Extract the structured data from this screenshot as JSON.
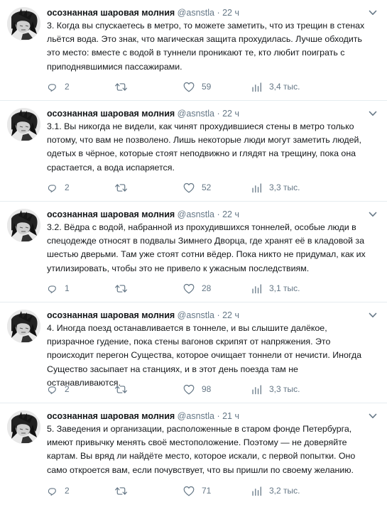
{
  "tweets": [
    {
      "name": "осознанная шаровая молния",
      "handle": "@asnstla",
      "dot": "·",
      "time": "22 ч",
      "text": "3. Когда вы спускаетесь в метро, то можете заметить, что из трещин в стенах льётся вода. Это знак, что магическая защита прохудилась. Лучше обходить это место: вместе с водой в туннели проникают те, кто любит поиграть с приподнявшимися пассажирами.",
      "replies": "2",
      "retweets": "",
      "likes": "59",
      "views": "3,4 тыс."
    },
    {
      "name": "осознанная шаровая молния",
      "handle": "@asnstla",
      "dot": "·",
      "time": "22 ч",
      "text": "3.1. Вы никогда не видели, как чинят прохудившиеся стены в метро только потому, что вам не позволено. Лишь некоторые люди могут заметить людей, одетых в чёрное, которые стоят неподвижно и глядят на трещину, пока она срастается, а вода испаряется.",
      "replies": "2",
      "retweets": "",
      "likes": "52",
      "views": "3,3 тыс."
    },
    {
      "name": "осознанная шаровая молния",
      "handle": "@asnstla",
      "dot": "·",
      "time": "22 ч",
      "text": "3.2. Вёдра с водой, набранной из прохудившихся тоннелей, особые люди в спецодежде относят в подвалы Зимнего Дворца, где хранят её в кладовой за шестью дверьми. Там уже стоят сотни вёдер. Пока никто не придумал, как их утилизировать, чтобы это не привело к ужасным последствиям.",
      "replies": "1",
      "retweets": "",
      "likes": "28",
      "views": "3,1 тыс."
    },
    {
      "name": "осознанная шаровая молния",
      "handle": "@asnstla",
      "dot": "·",
      "time": "22 ч",
      "text": "4. Иногда поезд останавливается в тоннеле, и вы слышите далёкое, призрачное гудение, пока стены вагонов скрипят от напряжения. Это происходит перегон Существа, которое очищает тоннели от нечисти. Иногда Существо засыпает на станциях, и в этот день поезда там не останавливаются.",
      "replies": "2",
      "retweets": "",
      "likes": "98",
      "views": "3,3 тыс."
    },
    {
      "name": "осознанная шаровая молния",
      "handle": "@asnstla",
      "dot": "·",
      "time": "21 ч",
      "text": "5. Заведения и организации, расположенные в старом фонде Петербурга, имеют привычку менять своё местоположение. Поэтому — не доверяйте картам. Вы вряд ли найдёте место, которое искали, с первой попытки. Оно само откроется вам, если почувствует, что вы пришли по своему желанию.",
      "replies": "2",
      "retweets": "",
      "likes": "71",
      "views": "3,2 тыс."
    }
  ],
  "icons": {
    "reply": "reply-icon",
    "retweet": "retweet-icon",
    "like": "like-icon",
    "views": "views-icon",
    "caret": "chevron-down-icon"
  },
  "colors": {
    "text": "#14171a",
    "secondary": "#657786",
    "divider": "#e6ecf0"
  }
}
